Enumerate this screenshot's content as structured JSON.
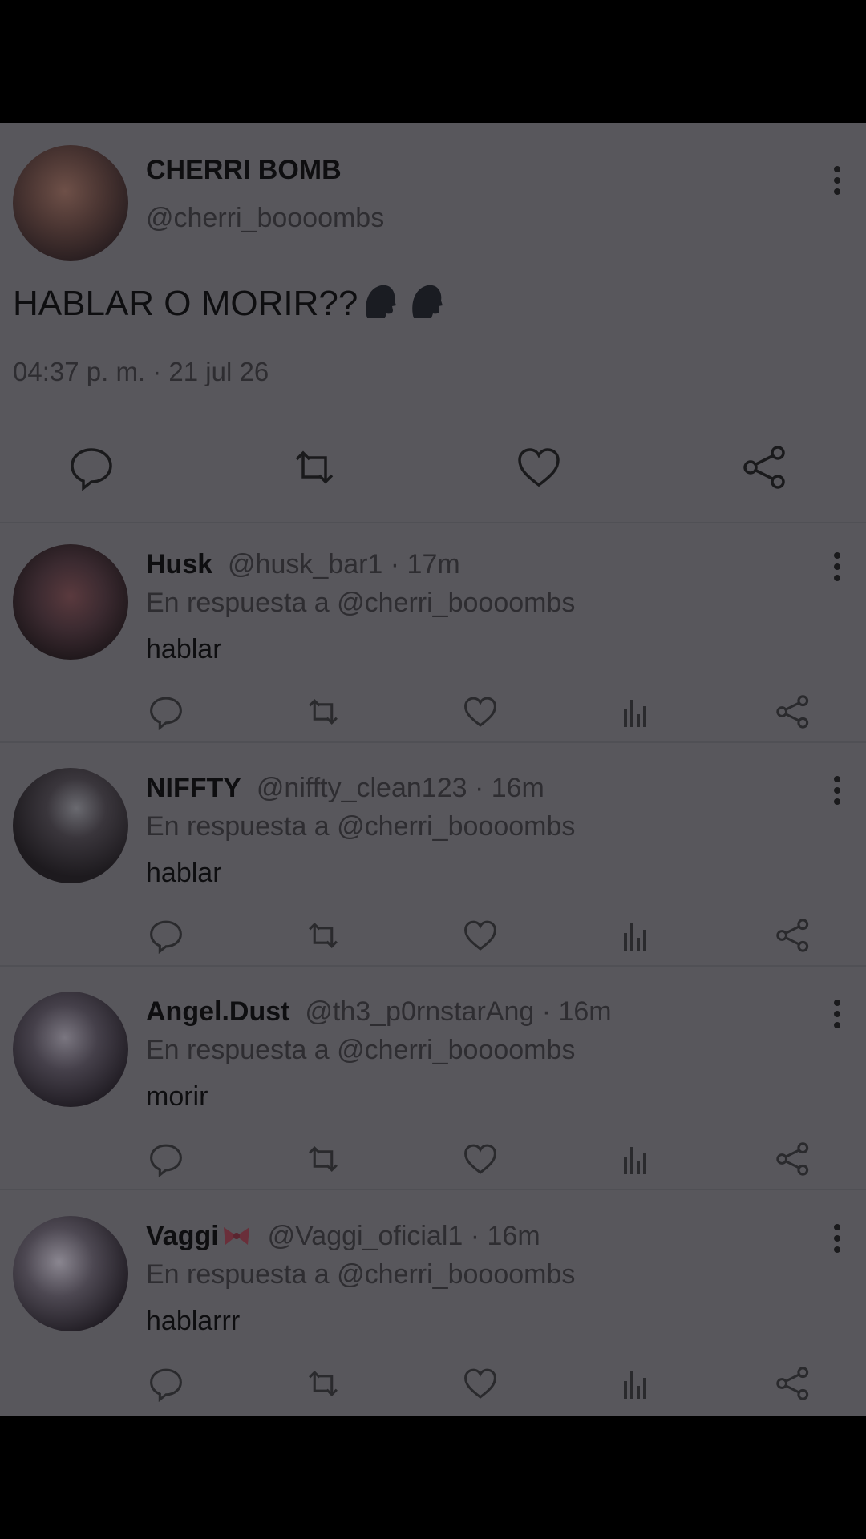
{
  "tweet": {
    "author_name": "CHERRI BOMB",
    "author_handle": "@cherri_boooombs",
    "text": "HABLAR O MORIR??",
    "timestamp": "04:37 p. m. · 21 jul 26",
    "icons": [
      "reply-icon",
      "retweet-icon",
      "like-icon",
      "share-icon"
    ]
  },
  "replies": [
    {
      "name": "Husk",
      "meta": "@husk_bar1 · 17m",
      "in_reply_to": "En respuesta a @cherri_boooombs",
      "text": "hablar"
    },
    {
      "name": "NIFFTY",
      "meta": "@niffty_clean123 · 16m",
      "in_reply_to": "En respuesta a @cherri_boooombs",
      "text": "hablar"
    },
    {
      "name": "Angel.Dust",
      "meta": "@th3_p0rnstarAng · 16m",
      "in_reply_to": "En respuesta a @cherri_boooombs",
      "text": "morir"
    },
    {
      "name": "Vaggi",
      "meta": "@Vaggi_oficial1 · 16m",
      "in_reply_to": "En respuesta a @cherri_boooombs",
      "text": "hablarrr"
    }
  ],
  "colors": {
    "overlay_bg": "#58575c",
    "letterbox": "#000000",
    "bow_accent": "#6a2f3a"
  }
}
